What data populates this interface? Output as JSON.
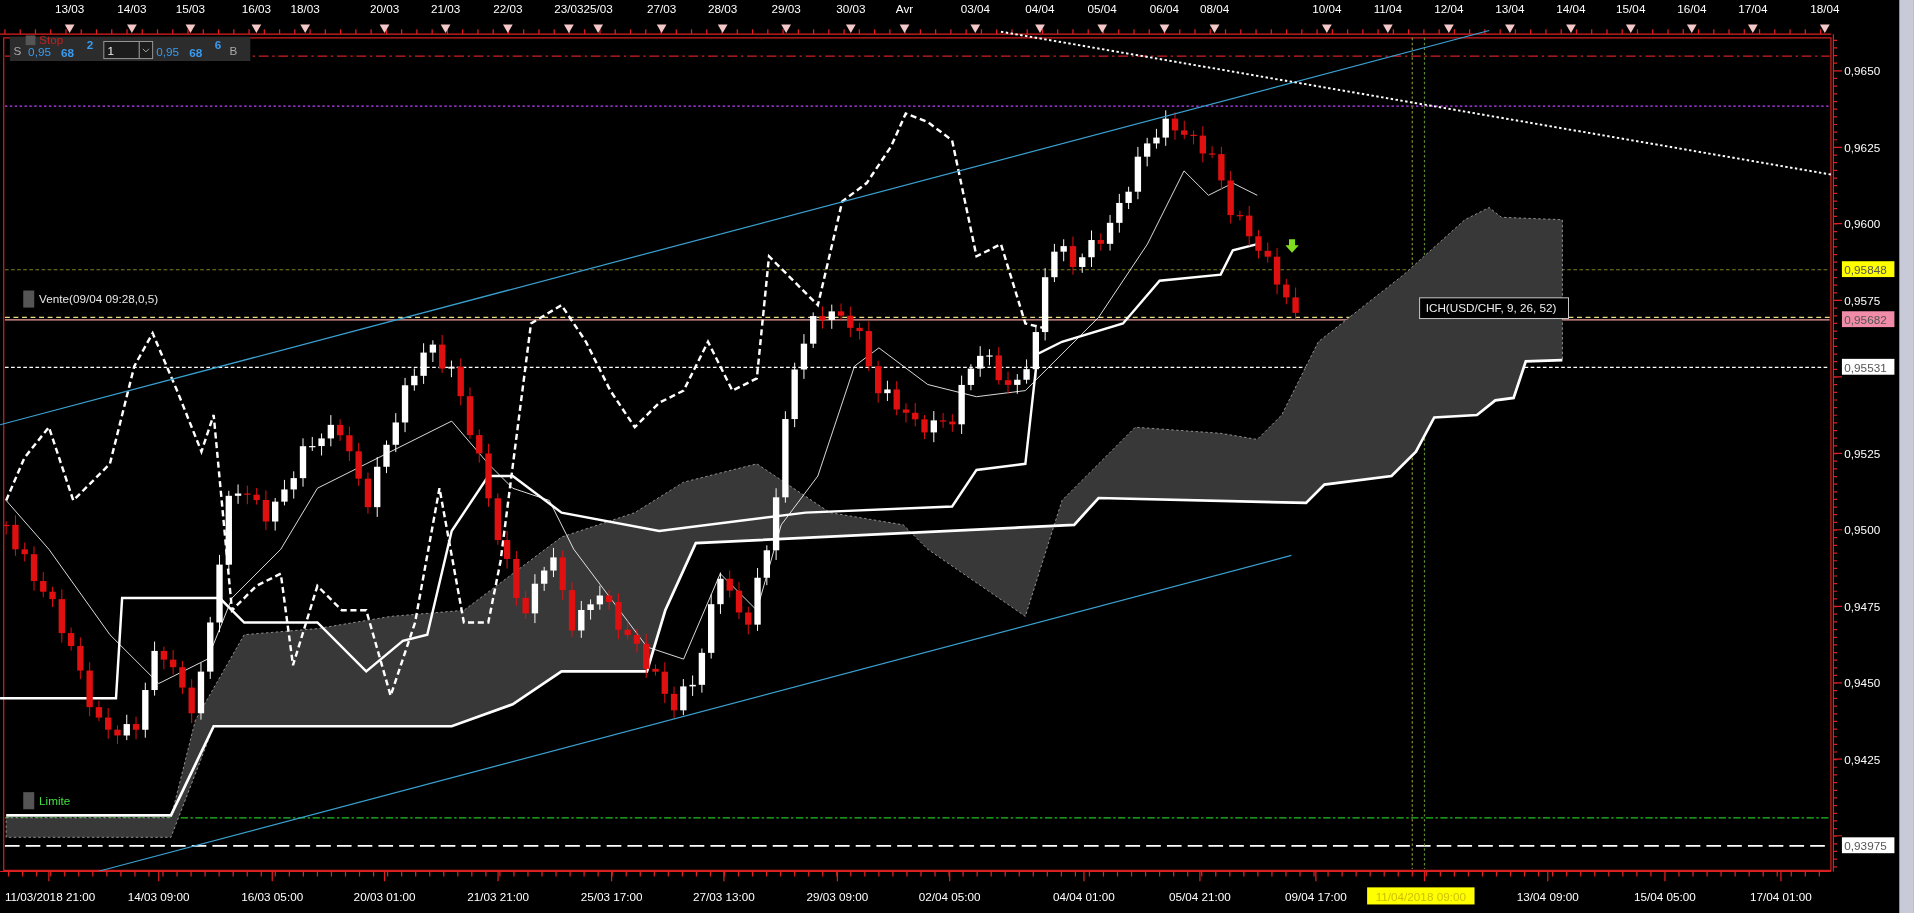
{
  "time_axis_top": {
    "labels": [
      "13/03",
      "14/03",
      "15/03",
      "16/03",
      "18/03",
      "20/03",
      "21/03",
      "22/03",
      "23/03",
      "25/03",
      "27/03",
      "28/03",
      "29/03",
      "30/03",
      "Avr",
      "03/04",
      "04/04",
      "05/04",
      "06/04",
      "08/04",
      "10/04",
      "11/04",
      "12/04",
      "13/04",
      "14/04",
      "15/04",
      "16/04",
      "17/04",
      "18/04"
    ]
  },
  "order_widget": {
    "stop_label": "Stop",
    "sell": {
      "letter": "S",
      "price_prefix": "0,95",
      "price_big": "68",
      "price_pip": "2"
    },
    "quantity": "1",
    "buy": {
      "letter": "B",
      "price_prefix": "0,95",
      "price_big": "68",
      "price_pip": "6"
    }
  },
  "chart": {
    "annotations": [
      {
        "kind": "order",
        "text": "Vente(09/04 09:28,0,5)"
      },
      {
        "kind": "limit",
        "text": "Limite"
      }
    ],
    "indicator_label": "ICH(USD/CHF, 9, 26, 52)"
  },
  "price_axis": {
    "labels": [
      "0,9650",
      "0,9625",
      "0,9600",
      "0,9575",
      "0,9525",
      "0,9500",
      "0,9475",
      "0,9450",
      "0,9425"
    ],
    "tags": [
      {
        "text": "0,95848",
        "color": "#ffff00"
      },
      {
        "text": "0,95682",
        "color": "#f08ca8"
      },
      {
        "text": "0,95531",
        "color": "#ffffff"
      },
      {
        "text": "0,93975",
        "color": "#ffffff"
      }
    ]
  },
  "time_axis_bottom": {
    "labels": [
      "11/03/2018 21:00",
      "14/03 09:00",
      "16/03 05:00",
      "20/03 01:00",
      "21/03 21:00",
      "25/03 17:00",
      "27/03 13:00",
      "29/03 09:00",
      "02/04 05:00",
      "04/04 01:00",
      "05/04 21:00",
      "09/04 17:00",
      "13/04 09:00",
      "15/04 05:00",
      "17/04 01:00"
    ],
    "cursor_label": "11/04/2018 09:00"
  }
}
